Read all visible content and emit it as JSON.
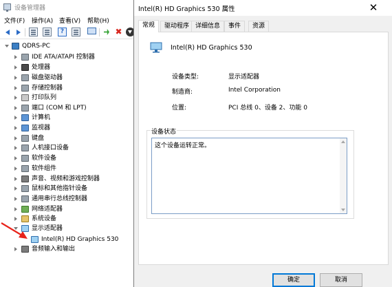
{
  "device_manager": {
    "title": "设备管理器",
    "menu": [
      "文件(F)",
      "操作(A)",
      "查看(V)",
      "帮助(H)"
    ],
    "toolbar": [
      "back-icon",
      "forward-icon",
      "properties-icon",
      "list-icon",
      "help-icon",
      "list-icon",
      "monitor-icon",
      "enable-icon",
      "uninstall-icon",
      "download-icon"
    ],
    "tree": {
      "root": "QDRS-PC",
      "items": [
        "IDE ATA/ATAPI 控制器",
        "处理器",
        "磁盘驱动器",
        "存储控制器",
        "打印队列",
        "端口 (COM 和 LPT)",
        "计算机",
        "监视器",
        "键盘",
        "人机接口设备",
        "软件设备",
        "软件组件",
        "声音、视频和游戏控制器",
        "鼠标和其他指针设备",
        "通用串行总线控制器",
        "网络适配器",
        "系统设备",
        "显示适配器"
      ],
      "child": "Intel(R) HD Graphics 530",
      "last": "音频输入和输出"
    }
  },
  "dialog": {
    "title": "Intel(R) HD Graphics 530 属性",
    "close_glyph": "✕",
    "tabs": [
      "常规",
      "驱动程序",
      "详细信息",
      "事件",
      "资源"
    ],
    "active_tab": "常规",
    "device_name": "Intel(R) HD Graphics 530",
    "props": {
      "type_label": "设备类型:",
      "type_value": "显示适配器",
      "manufacturer_label": "制造商:",
      "manufacturer_value": "Intel Corporation",
      "location_label": "位置:",
      "location_value": "PCI 总线 0、设备 2、功能 0"
    },
    "status_legend": "设备状态",
    "status_text": "这个设备运转正常。",
    "ok_label": "确定",
    "cancel_label": "取消"
  },
  "colors": {
    "annotation_arrow": "#e8231b",
    "accent": "#0078d7"
  }
}
